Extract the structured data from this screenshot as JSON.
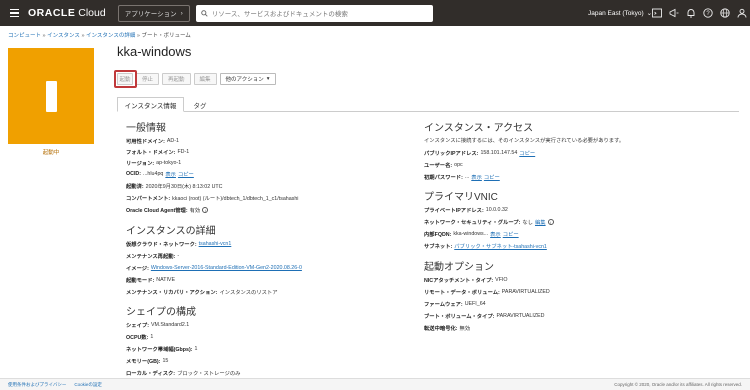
{
  "topbar": {
    "logo_bold": "ORACLE",
    "logo_text": " Cloud",
    "apps_label": "アプリケーション",
    "search_placeholder": "リソース、サービスおよびドキュメントの検索",
    "region": "Japan East (Tokyo)"
  },
  "breadcrumb": [
    "コンピュート",
    "インスタンス",
    "インスタンスの詳細",
    "ブート・ボリューム"
  ],
  "instance": {
    "name": "kka-windows",
    "state": "起動中"
  },
  "actions": {
    "start": "起動",
    "stop": "停止",
    "reboot": "再起動",
    "edit": "編集",
    "more": "他のアクション"
  },
  "tabs": {
    "info": "インスタンス情報",
    "tags": "タグ"
  },
  "general": {
    "title": "一般情報",
    "ad_label": "可用性ドメイン:",
    "ad_value": "AD-1",
    "fd_label": "フォルト・ドメイン:",
    "fd_value": "FD-1",
    "region_label": "リージョン:",
    "region_value": "ap-tokyo-1",
    "ocid_label": "OCID:",
    "ocid_value": "...hlu4pq",
    "ocid_show": "表示",
    "ocid_copy": "コピー",
    "launched_label": "起動済:",
    "launched_value": "2020年9月30日(木) 8:13:02 UTC",
    "compartment_label": "コンパートメント:",
    "compartment_value": "kkaoci (root) (ルート)/dbtech_1/dbtech_1_c1/tsahashi",
    "agent_label": "Oracle Cloud Agent管理:",
    "agent_value": "有効"
  },
  "details": {
    "title": "インスタンスの詳細",
    "vcn_label": "仮想クラウド・ネットワーク:",
    "vcn_value": "tsahashi-vcn1",
    "maint_label": "メンテナンス再起動:",
    "maint_value": "-",
    "image_label": "イメージ:",
    "image_value": "Windows-Server-2016-Standard-Edition-VM-Gen2-2020.08.26-0",
    "launch_mode_label": "起動モード:",
    "launch_mode_value": "NATIVE",
    "recovery_label": "メンテナンス・リカバリ・アクション:",
    "recovery_value": "インスタンスのリストア"
  },
  "shape": {
    "title": "シェイプの構成",
    "shape_label": "シェイプ:",
    "shape_value": "VM.Standard2.1",
    "ocpu_label": "OCPU数:",
    "ocpu_value": "1",
    "bandwidth_label": "ネットワーク帯域幅(Gbps):",
    "bandwidth_value": "1",
    "memory_label": "メモリー(GB):",
    "memory_value": "15",
    "disk_label": "ローカル・ディスク:",
    "disk_value": "ブロック・ストレージのみ"
  },
  "access": {
    "title": "インスタンス・アクセス",
    "desc": "インスタンスに接続するには、そのインスタンスが実行されている必要があります。",
    "ip_label": "パブリックIPアドレス:",
    "ip_value": "158.101.147.54",
    "ip_copy": "コピー",
    "user_label": "ユーザー名:",
    "user_value": "opc",
    "pw_label": "初期パスワード:",
    "pw_value": "...",
    "pw_show": "表示",
    "pw_copy": "コピー"
  },
  "vnic": {
    "title": "プライマリVNIC",
    "private_ip_label": "プライベートIPアドレス:",
    "private_ip_value": "10.0.0.32",
    "nsg_label": "ネットワーク・セキュリティ・グループ:",
    "nsg_value": "なし",
    "nsg_edit": "編集",
    "fqdn_label": "内部FQDN:",
    "fqdn_value": "kka-windows...",
    "fqdn_show": "表示",
    "fqdn_copy": "コピー",
    "subnet_label": "サブネット:",
    "subnet_value": "パブリック・サブネット-tsahashi-vcn1"
  },
  "launch_opts": {
    "title": "起動オプション",
    "nic_label": "NICアタッチメント・タイプ:",
    "nic_value": "VFIO",
    "remote_label": "リモート・データ・ボリューム:",
    "remote_value": "PARAVIRTUALIZED",
    "firmware_label": "ファームウェア:",
    "firmware_value": "UEFI_64",
    "boot_label": "ブート・ボリューム・タイプ:",
    "boot_value": "PARAVIRTUALIZED",
    "transit_label": "転送中暗号化:",
    "transit_value": "無効"
  },
  "footer": {
    "terms": "使用条件およびプライバシー",
    "cookie": "Cookieの設定",
    "copyright": "Copyright © 2020, Oracle and/or its affiliates. All rights reserved."
  }
}
